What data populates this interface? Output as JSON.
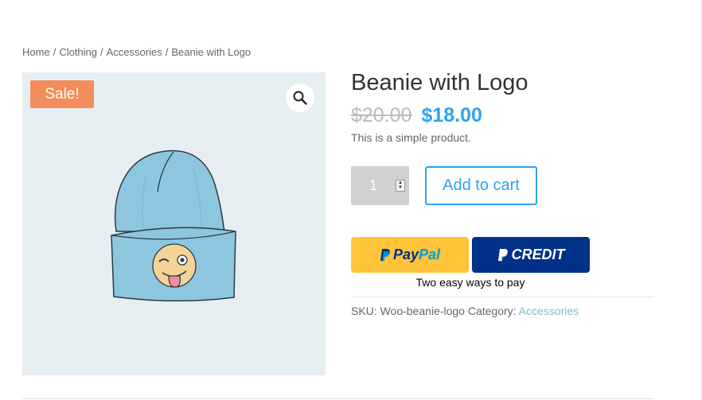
{
  "breadcrumb": {
    "items": [
      "Home",
      "Clothing",
      "Accessories",
      "Beanie with Logo"
    ],
    "separator": "/"
  },
  "gallery": {
    "sale_badge": "Sale!",
    "zoom_icon": "magnifier-icon",
    "background_color": "#e6eef2"
  },
  "product": {
    "title": "Beanie with Logo",
    "old_price": "$20.00",
    "new_price": "$18.00",
    "description": "This is a simple product.",
    "quantity": "1",
    "add_to_cart_label": "Add to cart"
  },
  "paypal": {
    "paypal_pay": "Pay",
    "paypal_pal": "Pal",
    "credit_label": "CREDIT",
    "tagline": "Two easy ways to pay"
  },
  "meta": {
    "sku_label": "SKU:",
    "sku_value": "Woo-beanie-logo",
    "category_label": "Category:",
    "category_value": "Accessories"
  },
  "colors": {
    "accent": "#2ea3f2",
    "sale": "#f48d5c",
    "paypal_yellow": "#ffc439",
    "paypal_blue": "#003087",
    "category_link": "#7dbccf"
  }
}
